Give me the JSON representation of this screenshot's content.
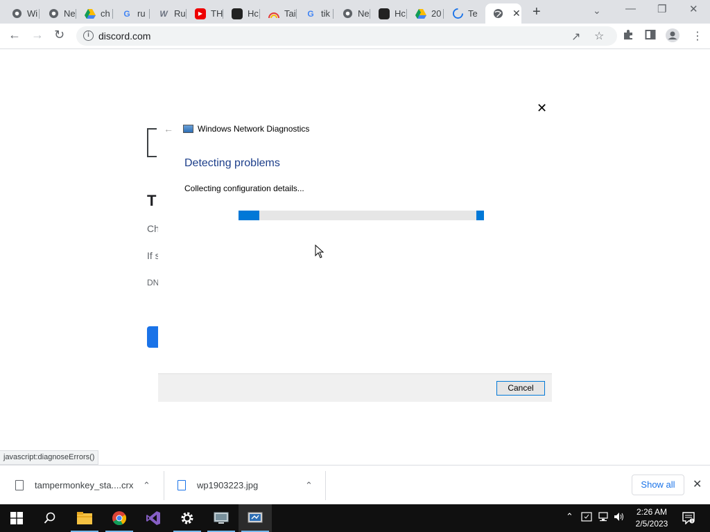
{
  "browser": {
    "tabs": [
      {
        "label": "Wi",
        "icon": "chrome-icon"
      },
      {
        "label": "Ne",
        "icon": "chrome-icon"
      },
      {
        "label": "ch",
        "icon": "google-drive-icon"
      },
      {
        "label": "ru",
        "icon": "google-icon"
      },
      {
        "label": "Ru",
        "icon": "wikipedia-icon"
      },
      {
        "label": "TH",
        "icon": "youtube-icon"
      },
      {
        "label": "Hc",
        "icon": "app-icon"
      },
      {
        "label": "Tai",
        "icon": "rainbow-icon"
      },
      {
        "label": "tik",
        "icon": "google-icon"
      },
      {
        "label": "Ne",
        "icon": "chrome-icon"
      },
      {
        "label": "Hc",
        "icon": "app-icon"
      },
      {
        "label": "20",
        "icon": "google-drive-icon"
      },
      {
        "label": "Te",
        "icon": "loading-icon"
      },
      {
        "label": "",
        "icon": "globe-icon",
        "active": true
      }
    ],
    "new_tab_symbol": "+",
    "url": "discord.com"
  },
  "dialog": {
    "app_title": "Windows Network Diagnostics",
    "heading": "Detecting problems",
    "status": "Collecting configuration details...",
    "progress_state": "indeterminate",
    "cancel_label": "Cancel"
  },
  "page": {
    "status_link": "javascript:diagnoseErrors()",
    "fragments": {
      "t": "T",
      "ch": "Ch",
      "ifs": "If s",
      "dn": "DN"
    }
  },
  "downloads": {
    "items": [
      {
        "name": "tampermonkey_sta....crx"
      },
      {
        "name": "wp1903223.jpg"
      }
    ],
    "show_all_label": "Show all"
  },
  "taskbar": {
    "time": "2:26 AM",
    "date": "2/5/2023"
  },
  "colors": {
    "accent": "#0078d7",
    "dialog_heading": "#1c3e8a",
    "tabstrip": "#dfe1e5",
    "taskbar": "#101010"
  }
}
